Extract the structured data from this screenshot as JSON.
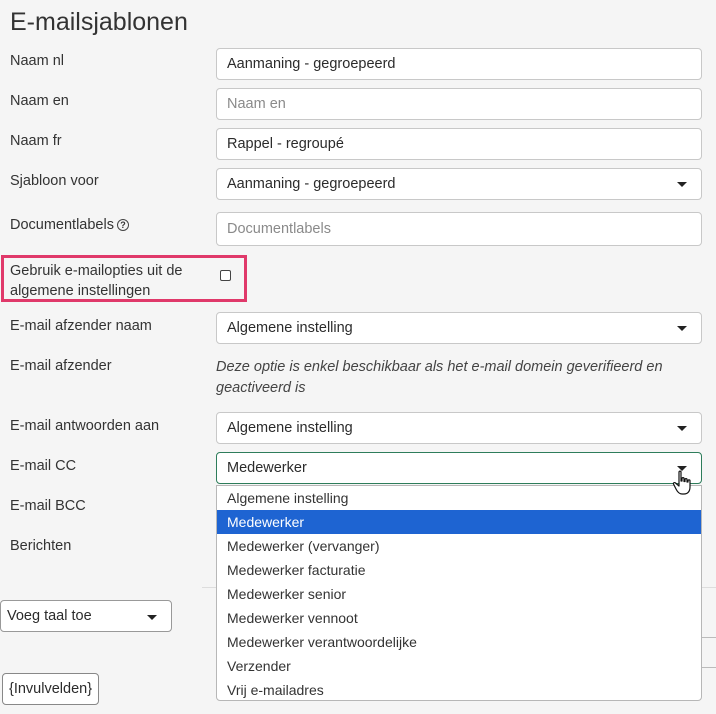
{
  "page": {
    "title": "E-mailsjablonen"
  },
  "form": {
    "name_nl": {
      "label": "Naam nl",
      "value": "Aanmaning - gegroepeerd"
    },
    "name_en": {
      "label": "Naam en",
      "placeholder": "Naam en"
    },
    "name_fr": {
      "label": "Naam fr",
      "value": "Rappel - regroupé"
    },
    "template_for": {
      "label": "Sjabloon voor",
      "value": "Aanmaning - gegroepeerd"
    },
    "document_labels": {
      "label": "Documentlabels",
      "placeholder": "Documentlabels"
    },
    "use_general": {
      "label_line1": "Gebruik e-mailopties uit de",
      "label_line2": "algemene instellingen",
      "checked": false
    },
    "sender_name": {
      "label": "E-mail afzender naam",
      "value": "Algemene instelling"
    },
    "sender": {
      "label": "E-mail afzender",
      "note_line1": "Deze optie is enkel beschikbaar als het e-mail domein geverifieerd en",
      "note_line2": "geactiveerd is"
    },
    "reply_to": {
      "label": "E-mail antwoorden aan",
      "value": "Algemene instelling"
    },
    "cc": {
      "label": "E-mail CC",
      "value": "Medewerker"
    },
    "bcc": {
      "label": "E-mail BCC"
    },
    "messages": {
      "label": "Berichten"
    }
  },
  "add_language": {
    "label": "Voeg taal toe"
  },
  "fields_button": {
    "label": "{Invulvelden}"
  },
  "cc_dropdown": {
    "selected_index": 1,
    "options": [
      "Algemene instelling",
      "Medewerker",
      "Medewerker (vervanger)",
      "Medewerker facturatie",
      "Medewerker senior",
      "Medewerker vennoot",
      "Medewerker verantwoordelijke",
      "Verzender",
      "Vrij e-mailadres"
    ]
  },
  "colors": {
    "highlight": "#e0396a",
    "selected_option": "#1e64d2",
    "focus_border": "#2e7d5b"
  }
}
